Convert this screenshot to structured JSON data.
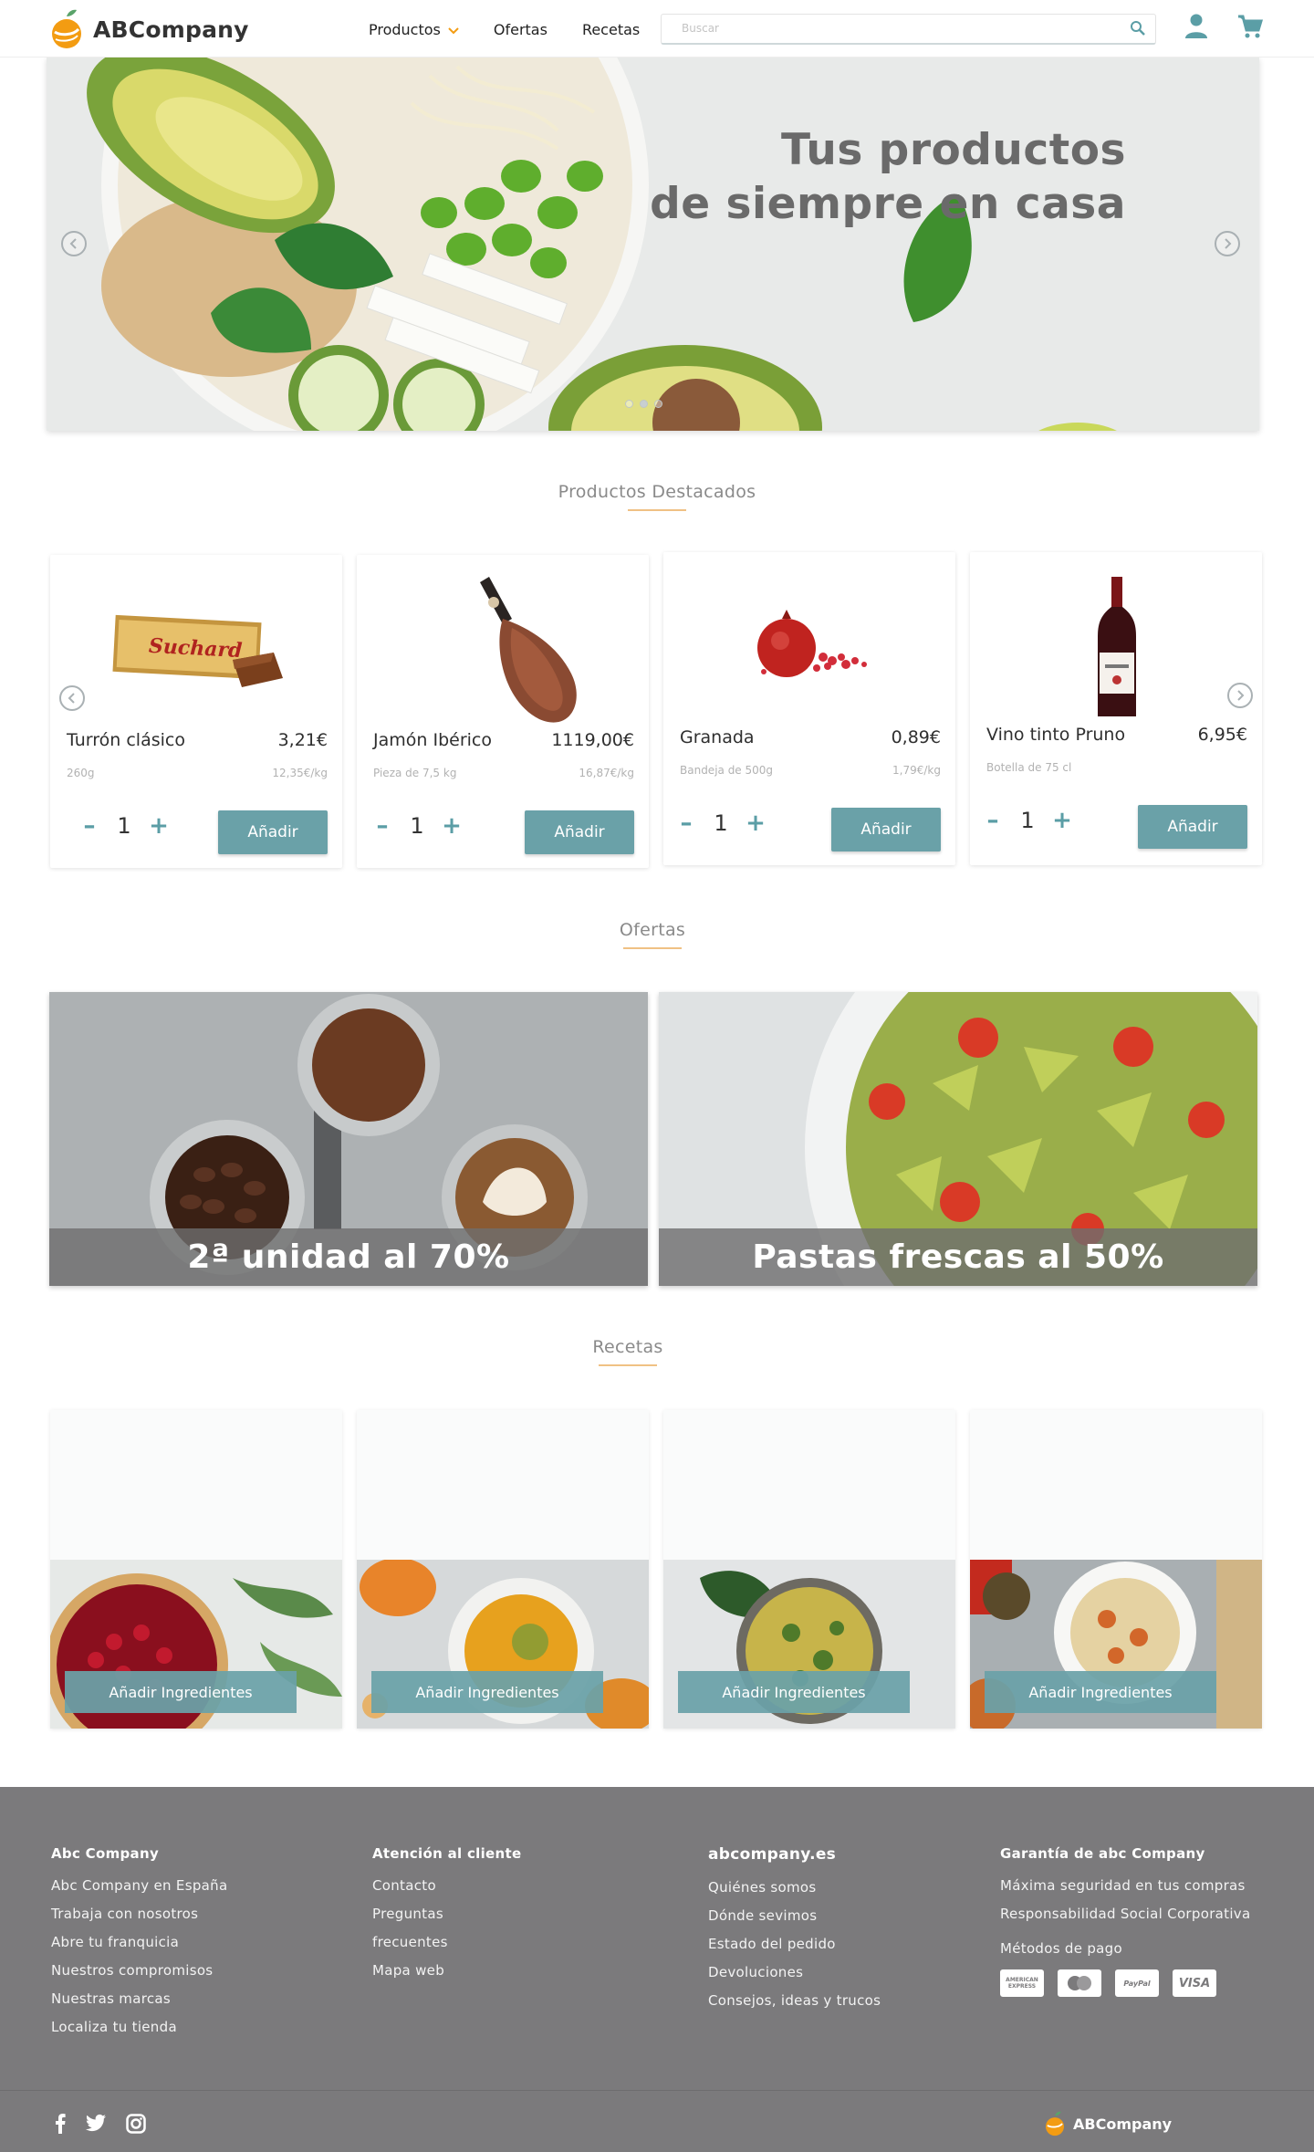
{
  "brand": {
    "name": "ABCompany"
  },
  "nav": {
    "items": [
      {
        "label": "Productos",
        "has_dropdown": true
      },
      {
        "label": "Ofertas"
      },
      {
        "label": "Recetas"
      }
    ],
    "search_placeholder": "Buscar"
  },
  "hero": {
    "title_line1": "Tus productos",
    "title_line2": "de siempre en casa",
    "slides": 3,
    "active_slide": 2
  },
  "featured": {
    "title": "Productos Destacados",
    "products": [
      {
        "name": "Turrón clásico",
        "price": "3,21€",
        "desc": "260g",
        "unit_price": "12,35€/kg",
        "qty": "1",
        "add_label": "Añadir",
        "image": "turron"
      },
      {
        "name": "Jamón Ibérico",
        "price": "1119,00€",
        "desc": "Pieza de 7,5 kg",
        "unit_price": "16,87€/kg",
        "qty": "1",
        "add_label": "Añadir",
        "image": "jamon"
      },
      {
        "name": "Granada",
        "price": "0,89€",
        "desc": "Bandeja de 500g",
        "unit_price": "1,79€/kg",
        "qty": "1",
        "add_label": "Añadir",
        "image": "granada"
      },
      {
        "name": "Vino tinto Pruno",
        "price": "6,95€",
        "desc": "Botella de 75 cl",
        "unit_price": "",
        "qty": "1",
        "add_label": "Añadir",
        "image": "vino"
      }
    ]
  },
  "offers": {
    "title": "Ofertas",
    "items": [
      {
        "label": "2ª unidad al 70%",
        "image": "coffee"
      },
      {
        "label": "Pastas frescas al 50%",
        "image": "pasta"
      }
    ]
  },
  "recipes": {
    "title": "Recetas",
    "items": [
      {
        "button": "Añadir Ingredientes",
        "image": "tart"
      },
      {
        "button": "Añadir Ingredientes",
        "image": "soup"
      },
      {
        "button": "Añadir Ingredientes",
        "image": "salad"
      },
      {
        "button": "Añadir Ingredientes",
        "image": "pasta-dish"
      }
    ]
  },
  "footer": {
    "col1": {
      "title": "Abc Company",
      "links": [
        "Abc Company en España",
        "Trabaja con nosotros",
        "Abre tu franquicia",
        "Nuestros compromisos",
        "Nuestras marcas",
        "Localiza tu tienda"
      ]
    },
    "col2": {
      "title": "Atención al cliente",
      "links": [
        "Contacto",
        "Preguntas",
        "frecuentes",
        "Mapa web"
      ]
    },
    "col3": {
      "title": "abcompany.es",
      "links": [
        "Quiénes somos",
        "Dónde sevimos",
        "Estado del pedido",
        "Devoluciones",
        "Consejos, ideas y trucos"
      ]
    },
    "col4": {
      "title": "Garantía de abc Company",
      "links": [
        "Máxima seguridad en tus compras",
        "Responsabilidad Social Corporativa",
        "Métodos de pago"
      ]
    },
    "payments": [
      "amex-icon",
      "mastercard-icon",
      "paypal-icon",
      "visa-icon"
    ],
    "payment_labels": [
      "AMERICAN EXPRESS",
      "",
      "PayPal",
      "VISA"
    ],
    "social": [
      "facebook-icon",
      "twitter-icon",
      "instagram-icon"
    ],
    "brand": "ABCompany"
  },
  "colors": {
    "accent": "#6aa1a8",
    "orange": "#f39c12",
    "footer_bg": "#7b7a7c",
    "underline": "#f0c184"
  }
}
